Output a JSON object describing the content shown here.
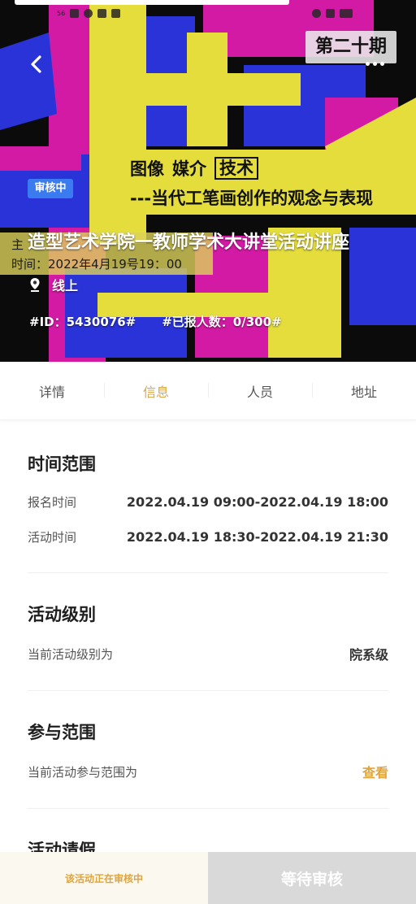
{
  "status_bar": {
    "left_text": "56",
    "colors": {
      "bar": "#ffffff"
    }
  },
  "poster": {
    "big_chars": [
      "技",
      "术"
    ],
    "issue": "第二十期",
    "subtitle_words": [
      "图像",
      "媒介",
      "技术"
    ],
    "subtitle_line2": "---当代工笔画创作的观念与表现",
    "ghost_host": "主",
    "ghost_time": "时间：2022年4月19号19：00",
    "colors": {
      "yellow": "#e4dd3b",
      "magenta": "#d21aa4",
      "blue": "#2a33d8"
    }
  },
  "header": {
    "status_badge": "审核中",
    "title": "造型艺术学院一教师学术大讲堂活动讲座",
    "location": "线上",
    "id_text": "#ID：5430076#",
    "signup_text": "#已报人数：0/300#"
  },
  "tabs": [
    {
      "label": "详情",
      "active": false
    },
    {
      "label": "信息",
      "active": true
    },
    {
      "label": "人员",
      "active": false
    },
    {
      "label": "地址",
      "active": false
    }
  ],
  "sections": {
    "time_range": {
      "title": "时间范围",
      "signup_label": "报名时间",
      "signup_value": "2022.04.19 09:00-2022.04.19 18:00",
      "activity_label": "活动时间",
      "activity_value": "2022.04.19 18:30-2022.04.19 21:30"
    },
    "level": {
      "title": "活动级别",
      "label": "当前活动级别为",
      "value": "院系级"
    },
    "scope": {
      "title": "参与范围",
      "label": "当前活动参与范围为",
      "link": "查看"
    },
    "leave": {
      "title": "活动请假"
    }
  },
  "bottom_bar": {
    "notice": "该活动正在审核中",
    "action": "等待审核"
  },
  "colors": {
    "accent": "#d9a649",
    "badge": "#3a7bf0",
    "disabled": "#d9d9d9"
  }
}
